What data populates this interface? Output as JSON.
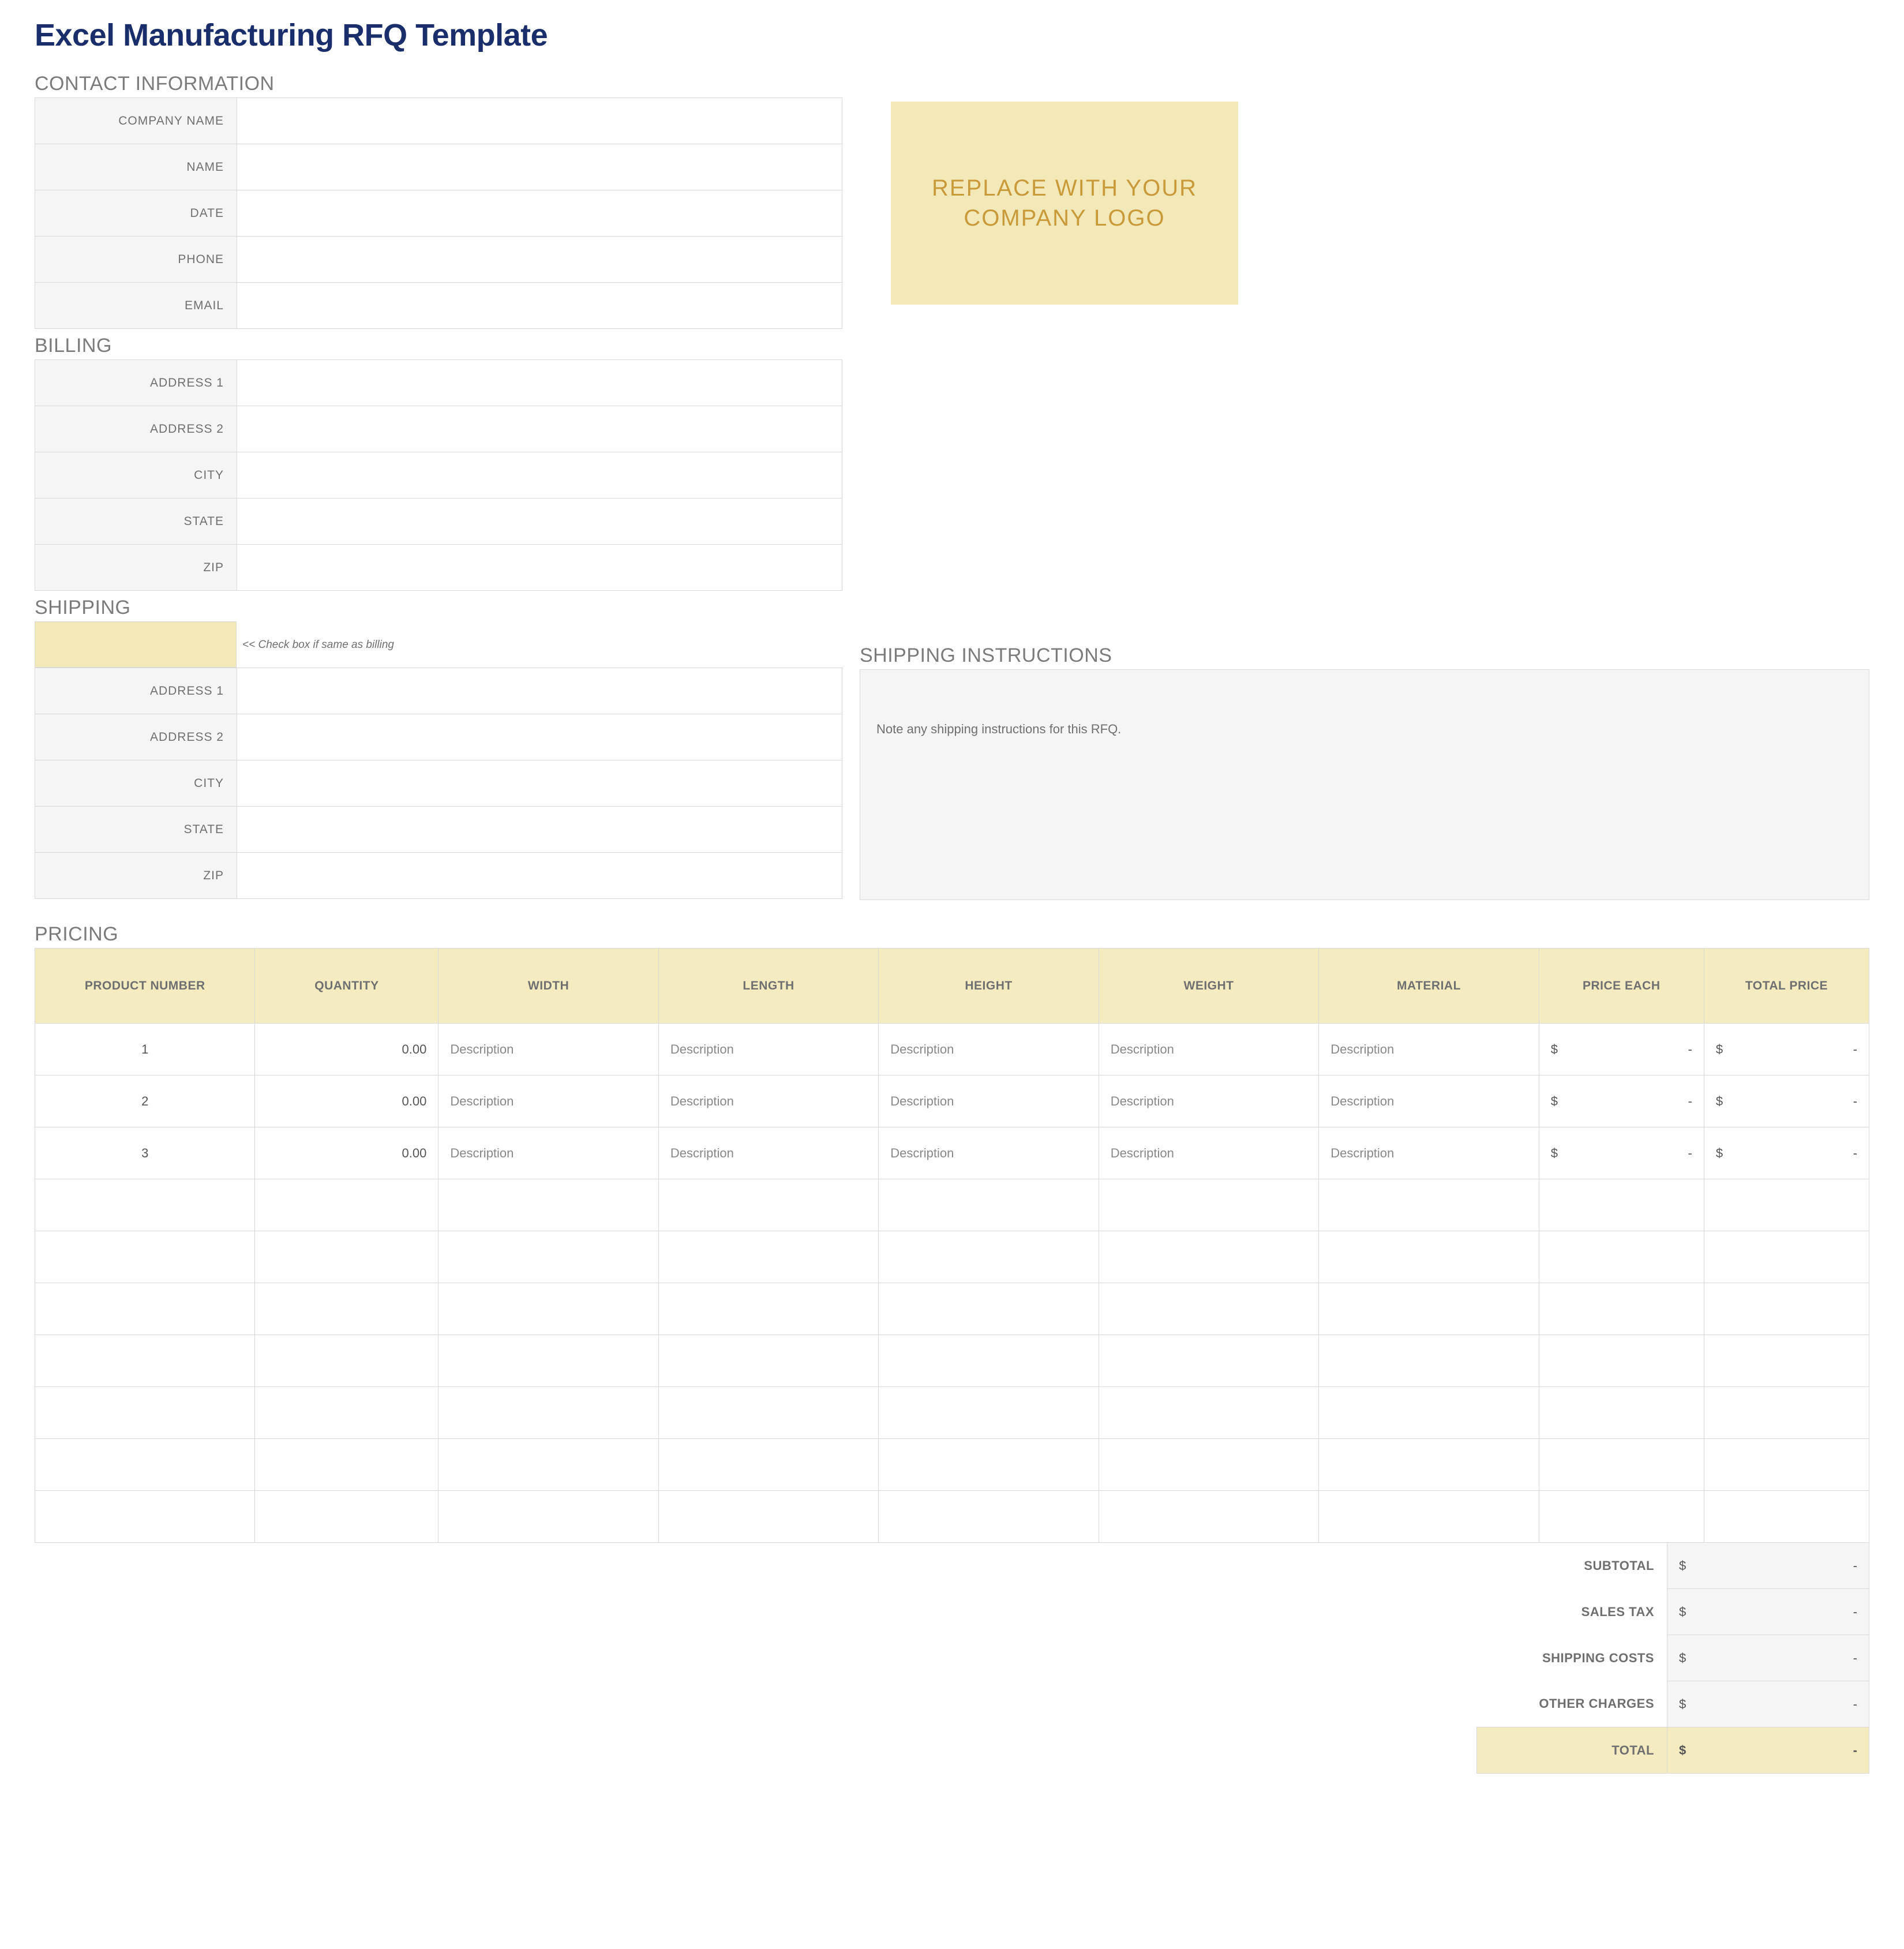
{
  "page_title": "Excel Manufacturing RFQ Template",
  "logo_placeholder": "REPLACE WITH YOUR COMPANY LOGO",
  "sections": {
    "contact": {
      "heading": "CONTACT INFORMATION",
      "fields": [
        {
          "label": "COMPANY NAME",
          "value": ""
        },
        {
          "label": "NAME",
          "value": ""
        },
        {
          "label": "DATE",
          "value": ""
        },
        {
          "label": "PHONE",
          "value": ""
        },
        {
          "label": "EMAIL",
          "value": ""
        }
      ]
    },
    "billing": {
      "heading": "BILLING",
      "fields": [
        {
          "label": "ADDRESS 1",
          "value": ""
        },
        {
          "label": "ADDRESS 2",
          "value": ""
        },
        {
          "label": "CITY",
          "value": ""
        },
        {
          "label": "STATE",
          "value": ""
        },
        {
          "label": "ZIP",
          "value": ""
        }
      ]
    },
    "shipping": {
      "heading": "SHIPPING",
      "check_note": "<< Check box if same as billing",
      "fields": [
        {
          "label": "ADDRESS 1",
          "value": ""
        },
        {
          "label": "ADDRESS 2",
          "value": ""
        },
        {
          "label": "CITY",
          "value": ""
        },
        {
          "label": "STATE",
          "value": ""
        },
        {
          "label": "ZIP",
          "value": ""
        }
      ],
      "instructions_heading": "SHIPPING INSTRUCTIONS",
      "instructions_text": "Note any shipping instructions for this RFQ."
    },
    "pricing": {
      "heading": "PRICING",
      "columns": [
        "PRODUCT NUMBER",
        "QUANTITY",
        "WIDTH",
        "LENGTH",
        "HEIGHT",
        "WEIGHT",
        "MATERIAL",
        "PRICE EACH",
        "TOTAL PRICE"
      ],
      "rows": [
        {
          "product_number": "1",
          "quantity": "0.00",
          "width": "Description",
          "length": "Description",
          "height": "Description",
          "weight": "Description",
          "material": "Description",
          "price_each": "-",
          "total_price": "-"
        },
        {
          "product_number": "2",
          "quantity": "0.00",
          "width": "Description",
          "length": "Description",
          "height": "Description",
          "weight": "Description",
          "material": "Description",
          "price_each": "-",
          "total_price": "-"
        },
        {
          "product_number": "3",
          "quantity": "0.00",
          "width": "Description",
          "length": "Description",
          "height": "Description",
          "weight": "Description",
          "material": "Description",
          "price_each": "-",
          "total_price": "-"
        },
        {
          "product_number": "",
          "quantity": "",
          "width": "",
          "length": "",
          "height": "",
          "weight": "",
          "material": "",
          "price_each": "",
          "total_price": ""
        },
        {
          "product_number": "",
          "quantity": "",
          "width": "",
          "length": "",
          "height": "",
          "weight": "",
          "material": "",
          "price_each": "",
          "total_price": ""
        },
        {
          "product_number": "",
          "quantity": "",
          "width": "",
          "length": "",
          "height": "",
          "weight": "",
          "material": "",
          "price_each": "",
          "total_price": ""
        },
        {
          "product_number": "",
          "quantity": "",
          "width": "",
          "length": "",
          "height": "",
          "weight": "",
          "material": "",
          "price_each": "",
          "total_price": ""
        },
        {
          "product_number": "",
          "quantity": "",
          "width": "",
          "length": "",
          "height": "",
          "weight": "",
          "material": "",
          "price_each": "",
          "total_price": ""
        },
        {
          "product_number": "",
          "quantity": "",
          "width": "",
          "length": "",
          "height": "",
          "weight": "",
          "material": "",
          "price_each": "",
          "total_price": ""
        },
        {
          "product_number": "",
          "quantity": "",
          "width": "",
          "length": "",
          "height": "",
          "weight": "",
          "material": "",
          "price_each": "",
          "total_price": ""
        }
      ],
      "currency_symbol": "$",
      "totals": [
        {
          "label": "SUBTOTAL",
          "value": "-"
        },
        {
          "label": "SALES TAX",
          "value": "-"
        },
        {
          "label": "SHIPPING COSTS",
          "value": "-"
        },
        {
          "label": "OTHER CHARGES",
          "value": "-"
        }
      ],
      "grand_total": {
        "label": "TOTAL",
        "value": "-"
      }
    }
  }
}
